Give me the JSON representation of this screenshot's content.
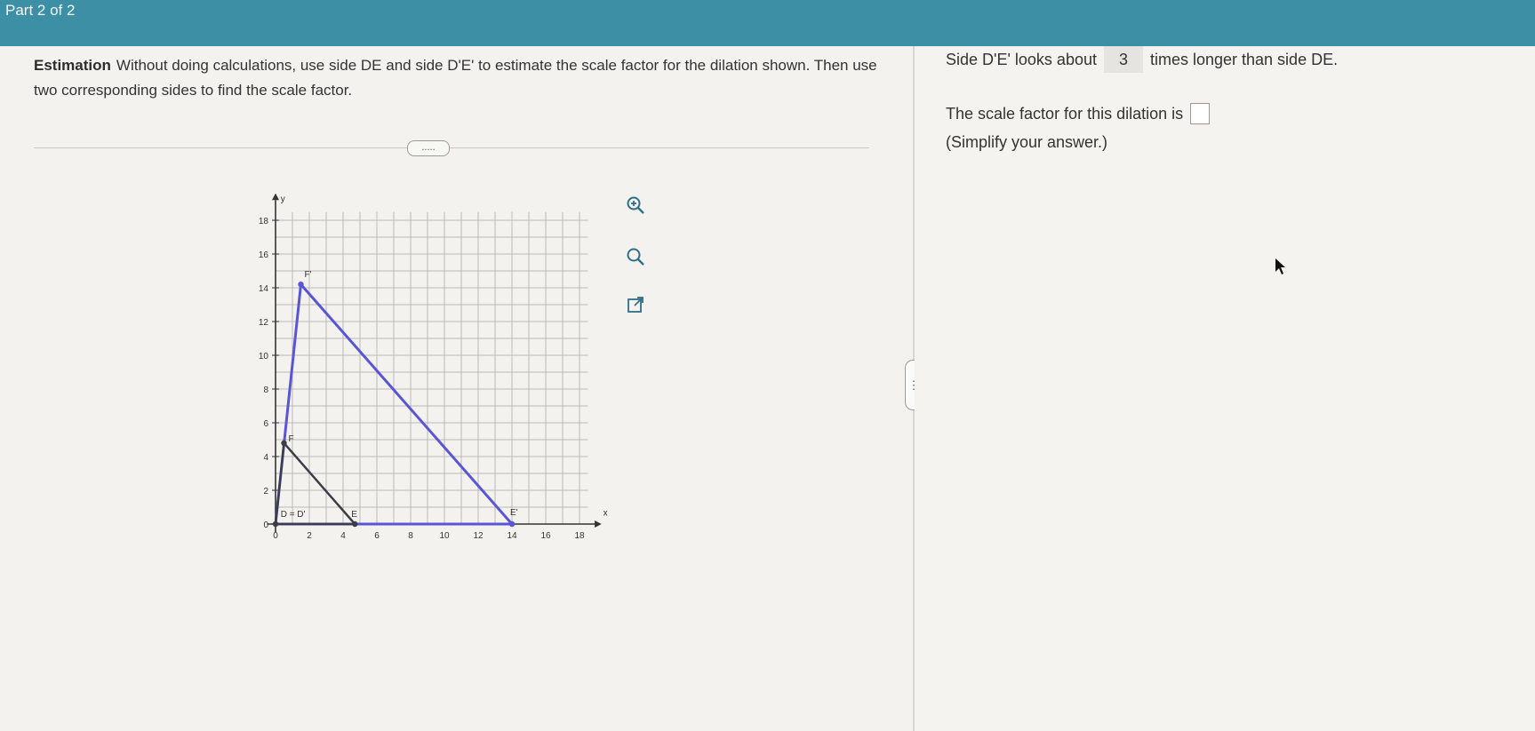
{
  "header": {
    "part_label": "Part 2 of 2"
  },
  "question": {
    "lead": "Estimation",
    "text": "Without doing calculations, use side DE and side D'E' to estimate the scale factor for the dilation shown. Then use two corresponding sides to find the scale factor.",
    "more_label": "....."
  },
  "graph": {
    "x_ticks": [
      "0",
      "2",
      "4",
      "6",
      "8",
      "10",
      "12",
      "14",
      "16",
      "18"
    ],
    "y_ticks": [
      "0",
      "2",
      "4",
      "6",
      "8",
      "10",
      "12",
      "14",
      "16",
      "18"
    ],
    "x_axis_label": "x",
    "y_axis_label": "y",
    "point_labels": {
      "F_prime": "F'",
      "F": "F",
      "D": "D = D'",
      "E": "E",
      "E_prime": "E'"
    },
    "big_triangle_color": "#5a55d6",
    "small_triangle_color": "#3d3d47"
  },
  "tools": {
    "zoom_in": "zoom-in-icon",
    "zoom_out": "zoom-out-icon",
    "popout": "popout-icon"
  },
  "answer": {
    "prefix": "Side D'E' looks about",
    "value": "3",
    "suffix": "times longer than side DE."
  },
  "scale": {
    "text": "The scale factor for this dilation is",
    "value": ""
  },
  "simplify": "(Simplify your answer.)",
  "divider_handle": "⋮"
}
